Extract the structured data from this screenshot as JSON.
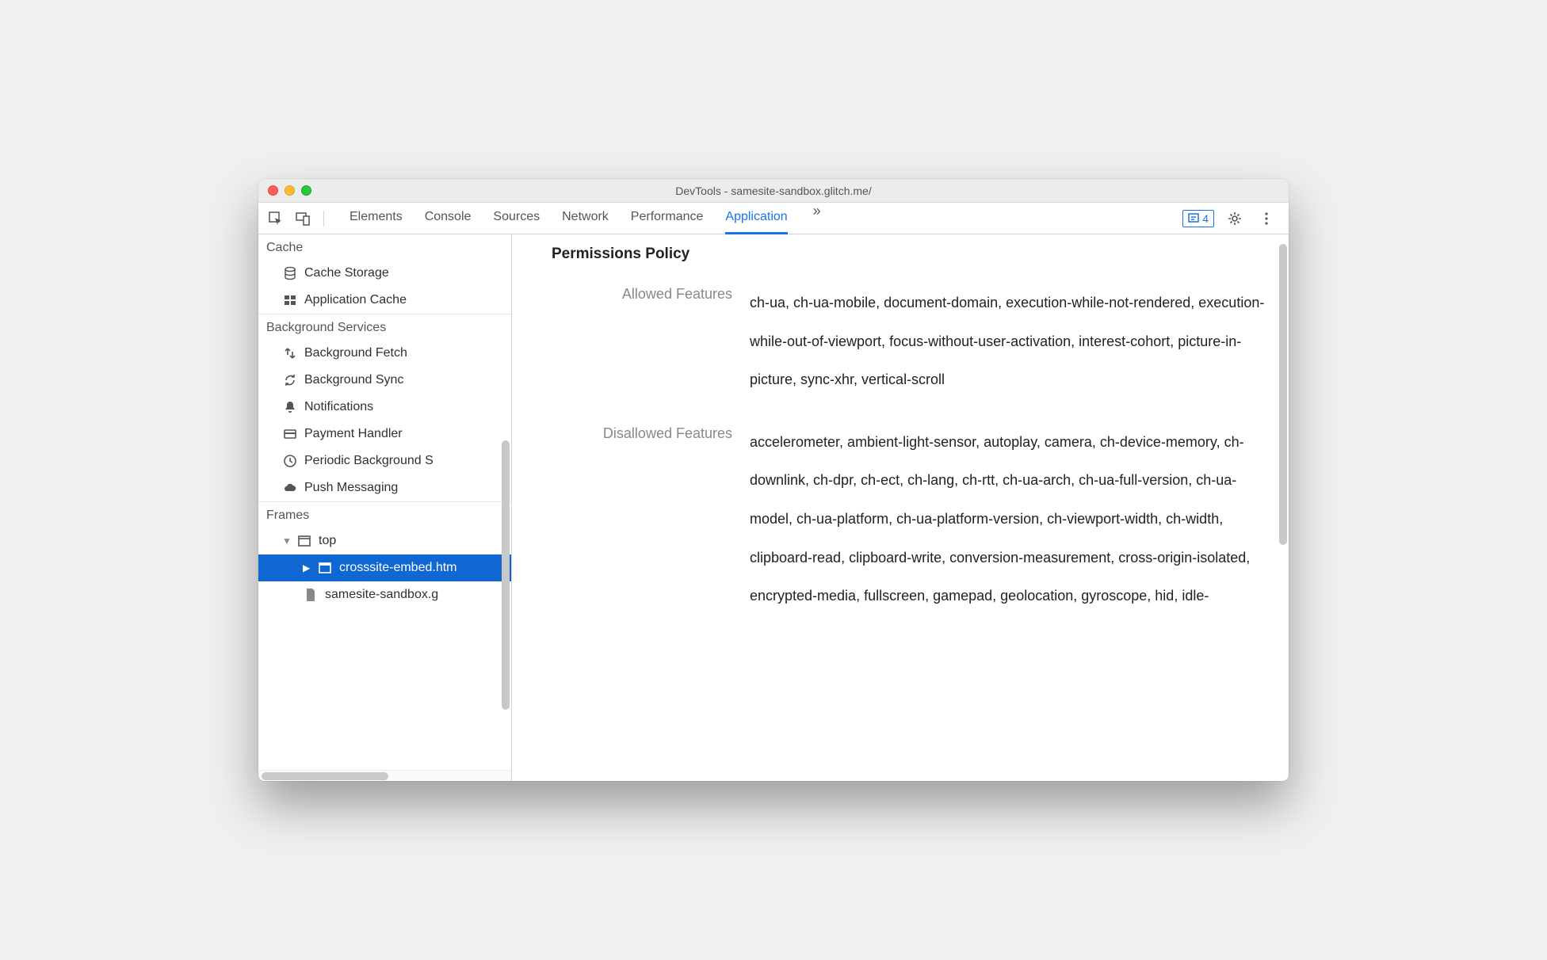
{
  "window": {
    "title": "DevTools - samesite-sandbox.glitch.me/"
  },
  "tabs": {
    "items": [
      "Elements",
      "Console",
      "Sources",
      "Network",
      "Performance",
      "Application"
    ],
    "active": "Application",
    "issues_count": "4"
  },
  "sidebar": {
    "cache": {
      "header": "Cache",
      "items": [
        "Cache Storage",
        "Application Cache"
      ]
    },
    "bg": {
      "header": "Background Services",
      "items": [
        "Background Fetch",
        "Background Sync",
        "Notifications",
        "Payment Handler",
        "Periodic Background S",
        "Push Messaging"
      ]
    },
    "frames": {
      "header": "Frames",
      "top": "top",
      "embed": "crosssite-embed.htm",
      "doc": "samesite-sandbox.g"
    }
  },
  "main": {
    "heading": "Permissions Policy",
    "allowed_label": "Allowed Features",
    "allowed_value": "ch-ua, ch-ua-mobile, document-domain, execution-while-not-rendered, execution-while-out-of-viewport, focus-without-user-activation, interest-cohort, picture-in-picture, sync-xhr, vertical-scroll",
    "disallowed_label": "Disallowed Features",
    "disallowed_value": "accelerometer, ambient-light-sensor, autoplay, camera, ch-device-memory, ch-downlink, ch-dpr, ch-ect, ch-lang, ch-rtt, ch-ua-arch, ch-ua-full-version, ch-ua-model, ch-ua-platform, ch-ua-platform-version, ch-viewport-width, ch-width, clipboard-read, clipboard-write, conversion-measurement, cross-origin-isolated, encrypted-media, fullscreen, gamepad, geolocation, gyroscope, hid, idle-"
  }
}
